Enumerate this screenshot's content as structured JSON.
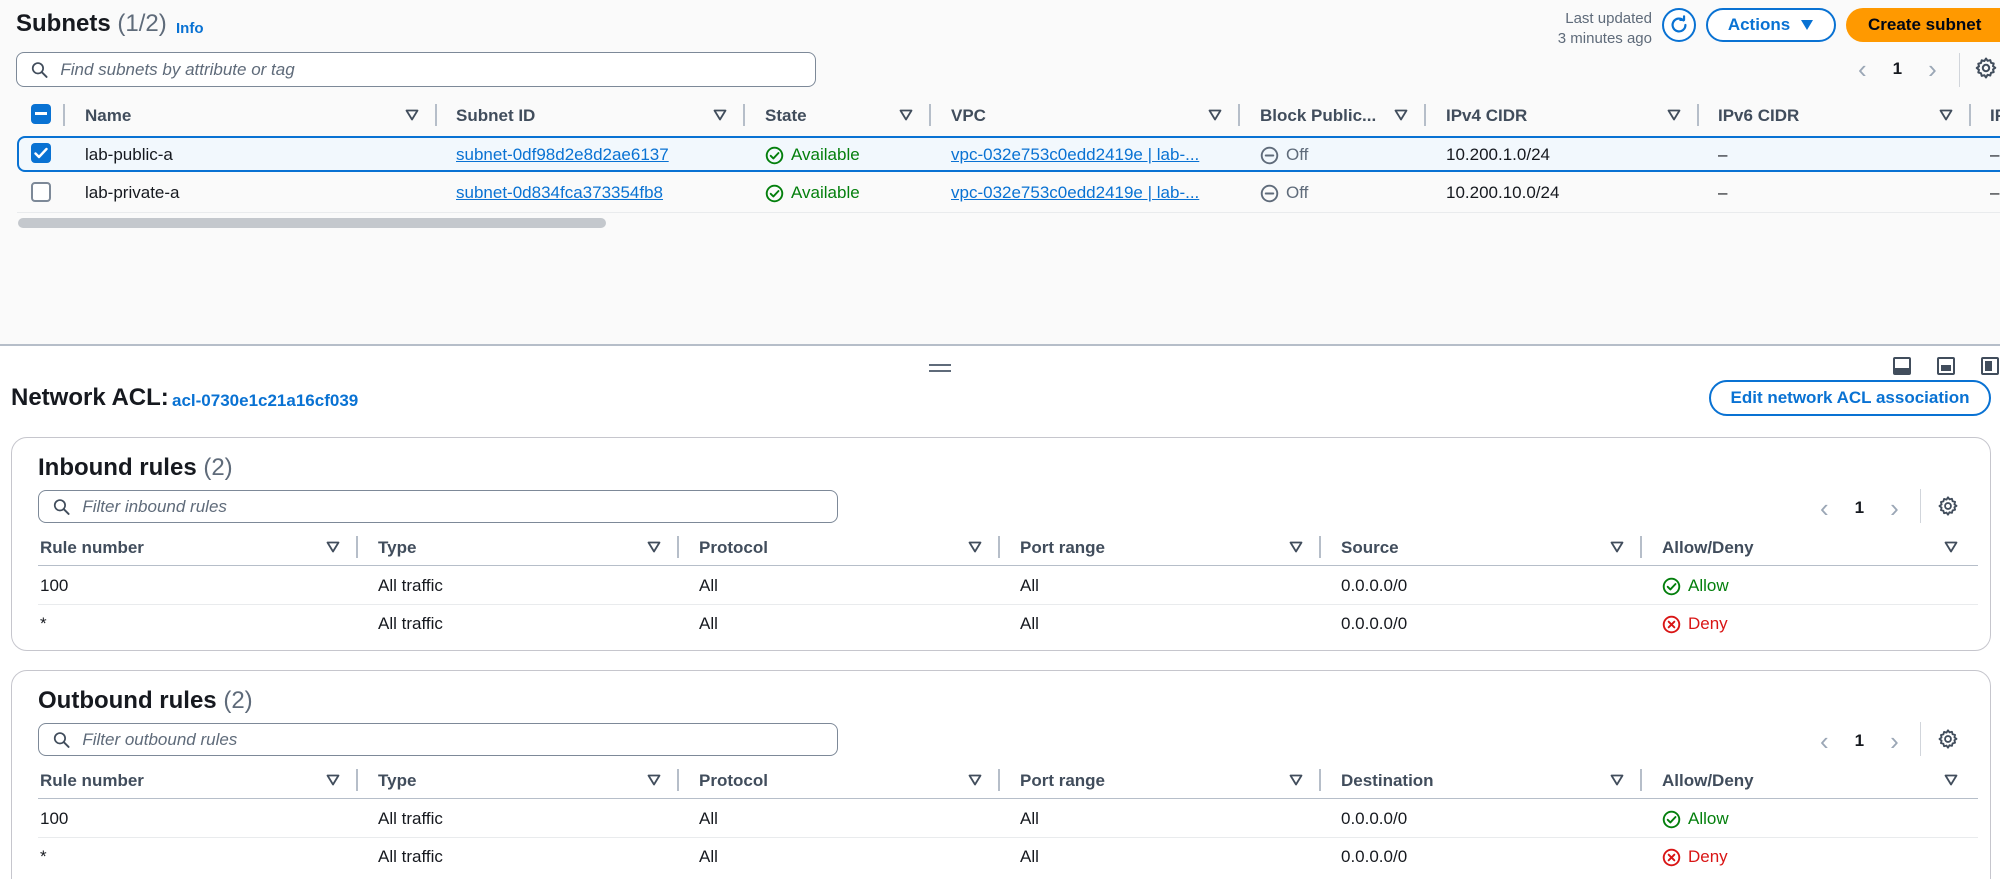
{
  "subnets": {
    "title": "Subnets",
    "count": "(1/2)",
    "info": "Info",
    "last_updated_line1": "Last updated",
    "last_updated_line2": "3 minutes ago",
    "actions_label": "Actions",
    "create_label": "Create subnet",
    "search_placeholder": "Find subnets by attribute or tag",
    "page": "1",
    "columns": [
      "Name",
      "Subnet ID",
      "State",
      "VPC",
      "Block Public...",
      "IPv4 CIDR",
      "IPv6 CIDR",
      "IP"
    ],
    "rows": [
      {
        "selected": true,
        "name": "lab-public-a",
        "subnet_id": "subnet-0df98d2e8d2ae6137",
        "state": "Available",
        "vpc": "vpc-032e753c0edd2419e | lab-...",
        "block_public": "Off",
        "ipv4": "10.200.1.0/24",
        "ipv6": "–",
        "extra": "–"
      },
      {
        "selected": false,
        "name": "lab-private-a",
        "subnet_id": "subnet-0d834fca373354fb8",
        "state": "Available",
        "vpc": "vpc-032e753c0edd2419e | lab-...",
        "block_public": "Off",
        "ipv4": "10.200.10.0/24",
        "ipv6": "–",
        "extra": "–"
      }
    ]
  },
  "acl": {
    "label": "Network ACL:",
    "id": "acl-0730e1c21a16cf039",
    "edit_label": "Edit network ACL association"
  },
  "inbound": {
    "title": "Inbound rules",
    "count": "(2)",
    "search_placeholder": "Filter inbound rules",
    "page": "1",
    "columns": [
      "Rule number",
      "Type",
      "Protocol",
      "Port range",
      "Source",
      "Allow/Deny"
    ],
    "rows": [
      {
        "rule": "100",
        "type": "All traffic",
        "protocol": "All",
        "port": "All",
        "addr": "0.0.0.0/0",
        "action": "Allow"
      },
      {
        "rule": "*",
        "type": "All traffic",
        "protocol": "All",
        "port": "All",
        "addr": "0.0.0.0/0",
        "action": "Deny"
      }
    ]
  },
  "outbound": {
    "title": "Outbound rules",
    "count": "(2)",
    "search_placeholder": "Filter outbound rules",
    "page": "1",
    "columns": [
      "Rule number",
      "Type",
      "Protocol",
      "Port range",
      "Destination",
      "Allow/Deny"
    ],
    "rows": [
      {
        "rule": "100",
        "type": "All traffic",
        "protocol": "All",
        "port": "All",
        "addr": "0.0.0.0/0",
        "action": "Allow"
      },
      {
        "rule": "*",
        "type": "All traffic",
        "protocol": "All",
        "port": "All",
        "addr": "0.0.0.0/0",
        "action": "Deny"
      }
    ]
  },
  "colors": {
    "accent": "#0972d3",
    "primary_button": "#ff9900",
    "success": "#037f0c",
    "error": "#d91515"
  }
}
